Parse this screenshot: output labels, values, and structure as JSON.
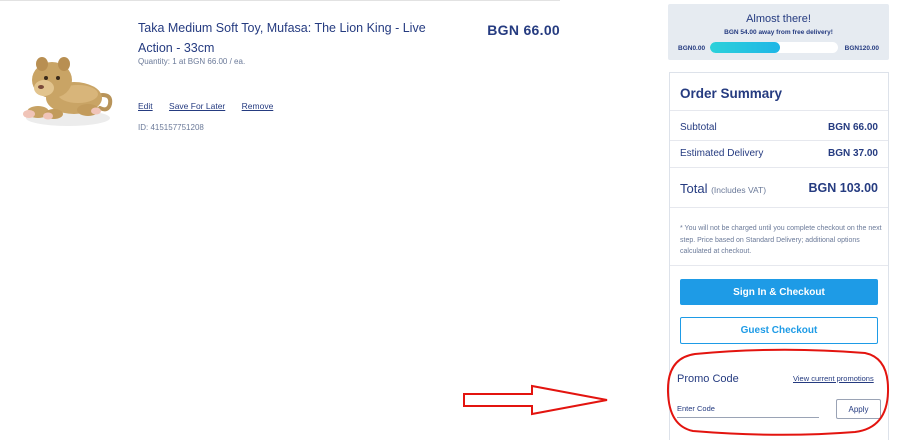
{
  "cart_item": {
    "title": "Taka Medium Soft Toy, Mufasa: The Lion King - Live Action - 33cm",
    "quantity_text": "Quantity: 1 at BGN 66.00 / ea.",
    "price": "BGN 66.00",
    "actions": {
      "edit": "Edit",
      "save_for_later": "Save For Later",
      "remove": "Remove"
    },
    "id_text": "ID: 415157751208"
  },
  "delivery": {
    "title": "Almost there!",
    "subtitle": "BGN 54.00 away from free delivery!",
    "min_label": "BGN0.00",
    "max_label": "BGN120.00",
    "progress": 0.55
  },
  "summary": {
    "title": "Order Summary",
    "subtotal_label": "Subtotal",
    "subtotal_value": "BGN 66.00",
    "delivery_label": "Estimated Delivery",
    "delivery_value": "BGN 37.00",
    "total_label": "Total",
    "total_note": "(Includes VAT)",
    "total_value": "BGN 103.00",
    "disclaimer": "* You will not be charged until you complete checkout on the next step. Price based on Standard Delivery; additional options calculated at checkout.",
    "signin_checkout": "Sign In & Checkout",
    "guest_checkout": "Guest Checkout"
  },
  "promo": {
    "title": "Promo Code",
    "view_promotions": "View current promotions",
    "placeholder": "Enter Code",
    "apply": "Apply"
  },
  "colors": {
    "brand_blue": "#1e9be6",
    "text_navy": "#253b80",
    "progress_teal": "#2cd1da",
    "annotation_red": "#e3140f"
  }
}
